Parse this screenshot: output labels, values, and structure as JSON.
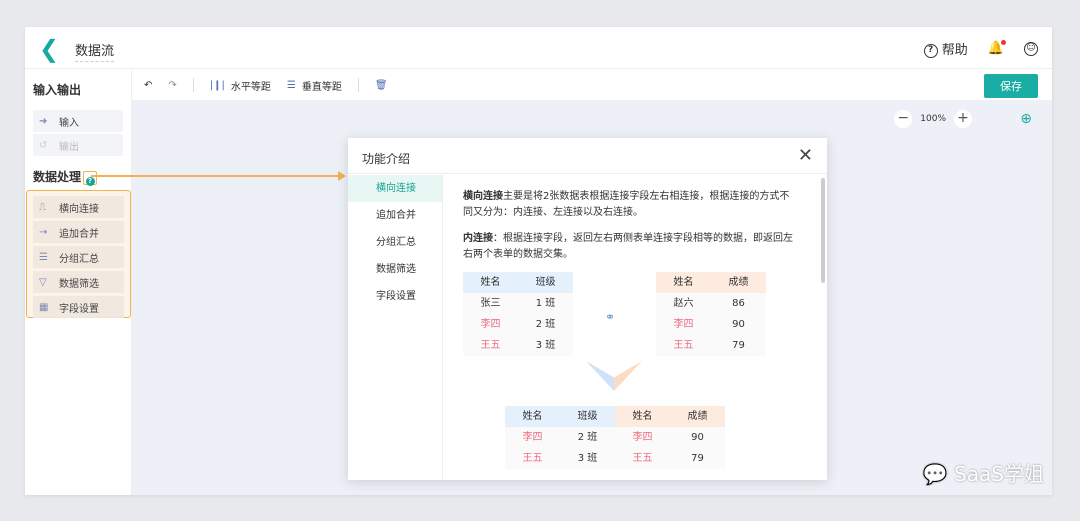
{
  "header": {
    "title": "数据流",
    "help": "帮助"
  },
  "sidebar": {
    "io_title": "输入输出",
    "io_items": [
      {
        "label": "输入",
        "icon": "input-icon"
      },
      {
        "label": "输出",
        "icon": "output-icon"
      }
    ],
    "proc_title": "数据处理",
    "proc_items": [
      {
        "label": "横向连接",
        "icon": "join-icon"
      },
      {
        "label": "追加合并",
        "icon": "merge-icon"
      },
      {
        "label": "分组汇总",
        "icon": "list-icon"
      },
      {
        "label": "数据筛选",
        "icon": "filter-icon"
      },
      {
        "label": "字段设置",
        "icon": "table-icon"
      }
    ]
  },
  "toolbar": {
    "h_space": "水平等距",
    "v_space": "垂直等距",
    "save": "保存"
  },
  "canvas": {
    "zoom": "100%"
  },
  "modal": {
    "title": "功能介绍",
    "nav": [
      "横向连接",
      "追加合并",
      "分组汇总",
      "数据筛选",
      "字段设置"
    ],
    "p1_bold": "横向连接",
    "p1": "主要是将2张数据表根据连接字段左右相连接，根据连接的方式不同又分为：内连接、左连接以及右连接。",
    "p2_bold": "内连接",
    "p2": "：根据连接字段，返回左右两侧表单连接字段相等的数据，即返回左右两个表单的数据交集。",
    "left": {
      "headers": [
        "姓名",
        "班级"
      ],
      "rows": [
        [
          "张三",
          "1 班"
        ],
        [
          "李四",
          "2 班"
        ],
        [
          "王五",
          "3 班"
        ]
      ]
    },
    "right": {
      "headers": [
        "姓名",
        "成绩"
      ],
      "rows": [
        [
          "赵六",
          "86"
        ],
        [
          "李四",
          "90"
        ],
        [
          "王五",
          "79"
        ]
      ]
    },
    "result": {
      "headers": [
        "姓名",
        "班级",
        "姓名",
        "成绩"
      ],
      "rows": [
        [
          "李四",
          "2 班",
          "李四",
          "90"
        ],
        [
          "王五",
          "3 班",
          "王五",
          "79"
        ]
      ]
    }
  },
  "watermark": "SaaS学姐"
}
